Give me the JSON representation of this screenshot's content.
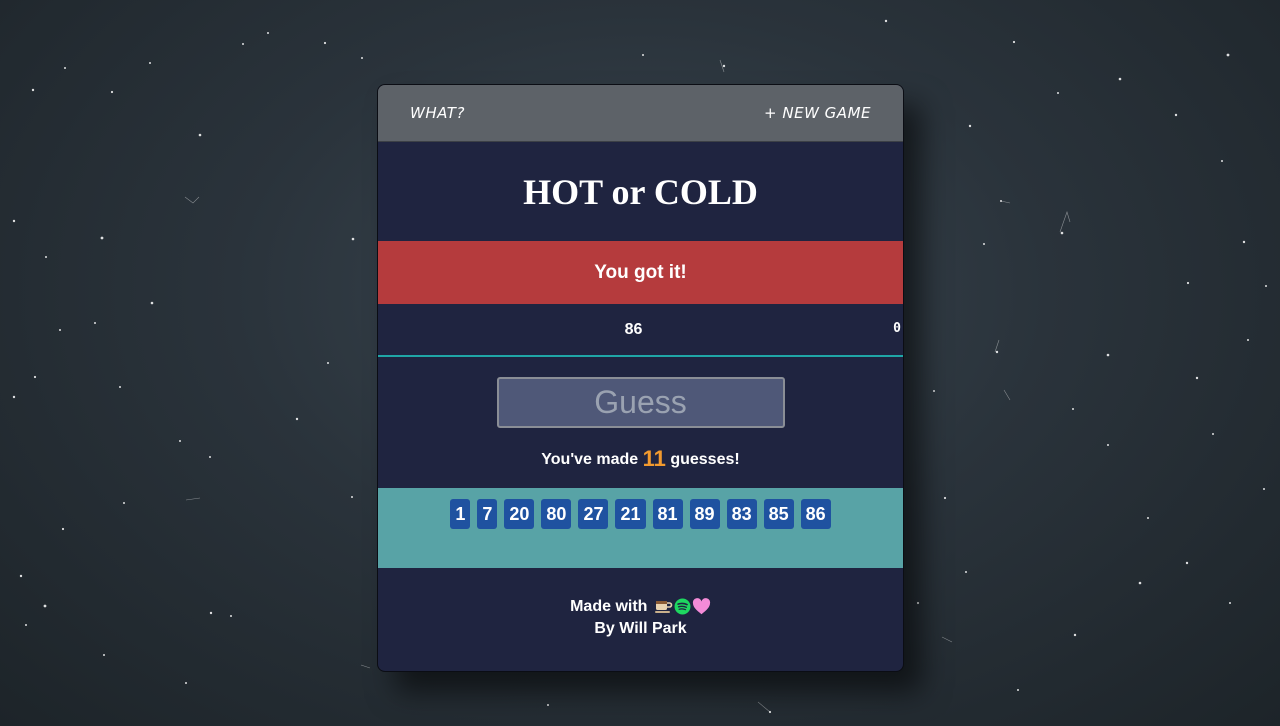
{
  "nav": {
    "what_label": "WHAT?",
    "new_game_label": "+ NEW GAME"
  },
  "title": "HOT or COLD",
  "feedback": "You got it!",
  "current_number": "86",
  "side_value": "0",
  "guess_input": {
    "placeholder": "Guess",
    "value": ""
  },
  "guess_count": {
    "prefix": "You've made",
    "count": "11",
    "suffix": "guesses!"
  },
  "history": [
    "1",
    "7",
    "20",
    "80",
    "27",
    "21",
    "81",
    "89",
    "83",
    "85",
    "86"
  ],
  "footer": {
    "made_with": "Made with",
    "icons": [
      "coffee-icon",
      "spotify-icon",
      "heart-icon"
    ],
    "author": "By Will Park"
  },
  "colors": {
    "card_bg": "#1f2440",
    "nav_bg": "#5d6268",
    "feedback_bg": "#b53b3d",
    "accent_line": "#1fa6a6",
    "history_bg": "#58a3a6",
    "chip_bg": "#1f52a0",
    "count_color": "#f29a2e"
  }
}
